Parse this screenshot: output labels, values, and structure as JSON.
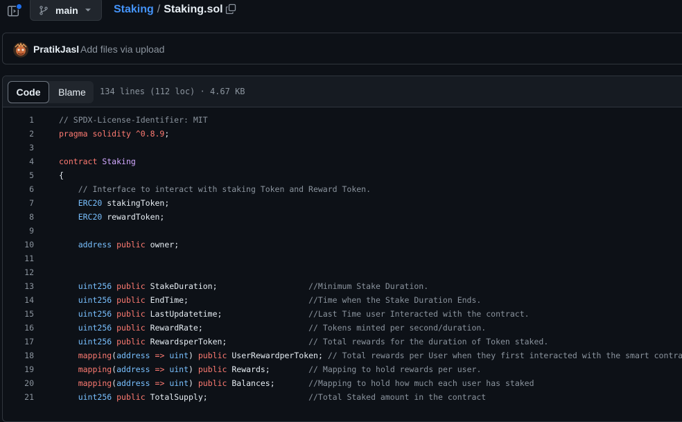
{
  "topbar": {
    "branch": "main",
    "repo": "Staking",
    "separator": "/",
    "file": "Staking.sol"
  },
  "commit": {
    "author": "PratikJasl",
    "message": "Add files via upload"
  },
  "file_header": {
    "code_tab": "Code",
    "blame_tab": "Blame",
    "info": "134 lines (112 loc) · 4.67 KB"
  },
  "colors": {
    "background": "#0d1117",
    "accent_link": "#4493f8",
    "keyword": "#ff7b72",
    "type": "#79c0ff",
    "name": "#d2a8ff",
    "comment": "#8b949e"
  },
  "code_lines": [
    {
      "n": "1",
      "tokens": [
        {
          "t": "c",
          "s": "// SPDX-License-Identifier: MIT"
        }
      ]
    },
    {
      "n": "2",
      "tokens": [
        {
          "t": "k",
          "s": "pragma"
        },
        {
          "t": "p",
          "s": " "
        },
        {
          "t": "k",
          "s": "solidity"
        },
        {
          "t": "p",
          "s": " "
        },
        {
          "t": "k",
          "s": "^0.8.9"
        },
        {
          "t": "p",
          "s": ";"
        }
      ]
    },
    {
      "n": "3",
      "tokens": []
    },
    {
      "n": "4",
      "tokens": [
        {
          "t": "k",
          "s": "contract"
        },
        {
          "t": "p",
          "s": " "
        },
        {
          "t": "n",
          "s": "Staking"
        }
      ]
    },
    {
      "n": "5",
      "tokens": [
        {
          "t": "p",
          "s": "{"
        }
      ]
    },
    {
      "n": "6",
      "tokens": [
        {
          "t": "c",
          "s": "    // Interface to interact with staking Token and Reward Token."
        }
      ]
    },
    {
      "n": "7",
      "tokens": [
        {
          "t": "p",
          "s": "    "
        },
        {
          "t": "t",
          "s": "ERC20"
        },
        {
          "t": "p",
          "s": " stakingToken;"
        }
      ]
    },
    {
      "n": "8",
      "tokens": [
        {
          "t": "p",
          "s": "    "
        },
        {
          "t": "t",
          "s": "ERC20"
        },
        {
          "t": "p",
          "s": " rewardToken;"
        }
      ]
    },
    {
      "n": "9",
      "tokens": []
    },
    {
      "n": "10",
      "tokens": [
        {
          "t": "p",
          "s": "    "
        },
        {
          "t": "t",
          "s": "address"
        },
        {
          "t": "p",
          "s": " "
        },
        {
          "t": "k",
          "s": "public"
        },
        {
          "t": "p",
          "s": " owner;"
        }
      ]
    },
    {
      "n": "11",
      "tokens": []
    },
    {
      "n": "12",
      "tokens": []
    },
    {
      "n": "13",
      "tokens": [
        {
          "t": "p",
          "s": "    "
        },
        {
          "t": "t",
          "s": "uint256"
        },
        {
          "t": "p",
          "s": " "
        },
        {
          "t": "k",
          "s": "public"
        },
        {
          "t": "p",
          "s": " StakeDuration;                   "
        },
        {
          "t": "c",
          "s": "//Minimum Stake Duration."
        }
      ]
    },
    {
      "n": "14",
      "tokens": [
        {
          "t": "p",
          "s": "    "
        },
        {
          "t": "t",
          "s": "uint256"
        },
        {
          "t": "p",
          "s": " "
        },
        {
          "t": "k",
          "s": "public"
        },
        {
          "t": "p",
          "s": " EndTime;                         "
        },
        {
          "t": "c",
          "s": "//Time when the Stake Duration Ends."
        }
      ]
    },
    {
      "n": "15",
      "tokens": [
        {
          "t": "p",
          "s": "    "
        },
        {
          "t": "t",
          "s": "uint256"
        },
        {
          "t": "p",
          "s": " "
        },
        {
          "t": "k",
          "s": "public"
        },
        {
          "t": "p",
          "s": " LastUpdatetime;                  "
        },
        {
          "t": "c",
          "s": "//Last Time user Interacted with the contract."
        }
      ]
    },
    {
      "n": "16",
      "tokens": [
        {
          "t": "p",
          "s": "    "
        },
        {
          "t": "t",
          "s": "uint256"
        },
        {
          "t": "p",
          "s": " "
        },
        {
          "t": "k",
          "s": "public"
        },
        {
          "t": "p",
          "s": " RewardRate;                      "
        },
        {
          "t": "c",
          "s": "// Tokens minted per second/duration."
        }
      ]
    },
    {
      "n": "17",
      "tokens": [
        {
          "t": "p",
          "s": "    "
        },
        {
          "t": "t",
          "s": "uint256"
        },
        {
          "t": "p",
          "s": " "
        },
        {
          "t": "k",
          "s": "public"
        },
        {
          "t": "p",
          "s": " RewardsperToken;                 "
        },
        {
          "t": "c",
          "s": "// Total rewards for the duration of Token staked."
        }
      ]
    },
    {
      "n": "18",
      "tokens": [
        {
          "t": "p",
          "s": "    "
        },
        {
          "t": "k",
          "s": "mapping"
        },
        {
          "t": "p",
          "s": "("
        },
        {
          "t": "t",
          "s": "address"
        },
        {
          "t": "p",
          "s": " "
        },
        {
          "t": "k",
          "s": "=>"
        },
        {
          "t": "p",
          "s": " "
        },
        {
          "t": "t",
          "s": "uint"
        },
        {
          "t": "p",
          "s": ") "
        },
        {
          "t": "k",
          "s": "public"
        },
        {
          "t": "p",
          "s": " UserRewardperToken; "
        },
        {
          "t": "c",
          "s": "// Total rewards per User when they first interacted with the smart contract."
        }
      ]
    },
    {
      "n": "19",
      "tokens": [
        {
          "t": "p",
          "s": "    "
        },
        {
          "t": "k",
          "s": "mapping"
        },
        {
          "t": "p",
          "s": "("
        },
        {
          "t": "t",
          "s": "address"
        },
        {
          "t": "p",
          "s": " "
        },
        {
          "t": "k",
          "s": "=>"
        },
        {
          "t": "p",
          "s": " "
        },
        {
          "t": "t",
          "s": "uint"
        },
        {
          "t": "p",
          "s": ") "
        },
        {
          "t": "k",
          "s": "public"
        },
        {
          "t": "p",
          "s": " Rewards;        "
        },
        {
          "t": "c",
          "s": "// Mapping to hold rewards per user."
        }
      ]
    },
    {
      "n": "20",
      "tokens": [
        {
          "t": "p",
          "s": "    "
        },
        {
          "t": "k",
          "s": "mapping"
        },
        {
          "t": "p",
          "s": "("
        },
        {
          "t": "t",
          "s": "address"
        },
        {
          "t": "p",
          "s": " "
        },
        {
          "t": "k",
          "s": "=>"
        },
        {
          "t": "p",
          "s": " "
        },
        {
          "t": "t",
          "s": "uint"
        },
        {
          "t": "p",
          "s": ") "
        },
        {
          "t": "k",
          "s": "public"
        },
        {
          "t": "p",
          "s": " Balances;       "
        },
        {
          "t": "c",
          "s": "//Mapping to hold how much each user has staked"
        }
      ]
    },
    {
      "n": "21",
      "tokens": [
        {
          "t": "p",
          "s": "    "
        },
        {
          "t": "t",
          "s": "uint256"
        },
        {
          "t": "p",
          "s": " "
        },
        {
          "t": "k",
          "s": "public"
        },
        {
          "t": "p",
          "s": " TotalSupply;                     "
        },
        {
          "t": "c",
          "s": "//Total Staked amount in the contract"
        }
      ]
    }
  ]
}
